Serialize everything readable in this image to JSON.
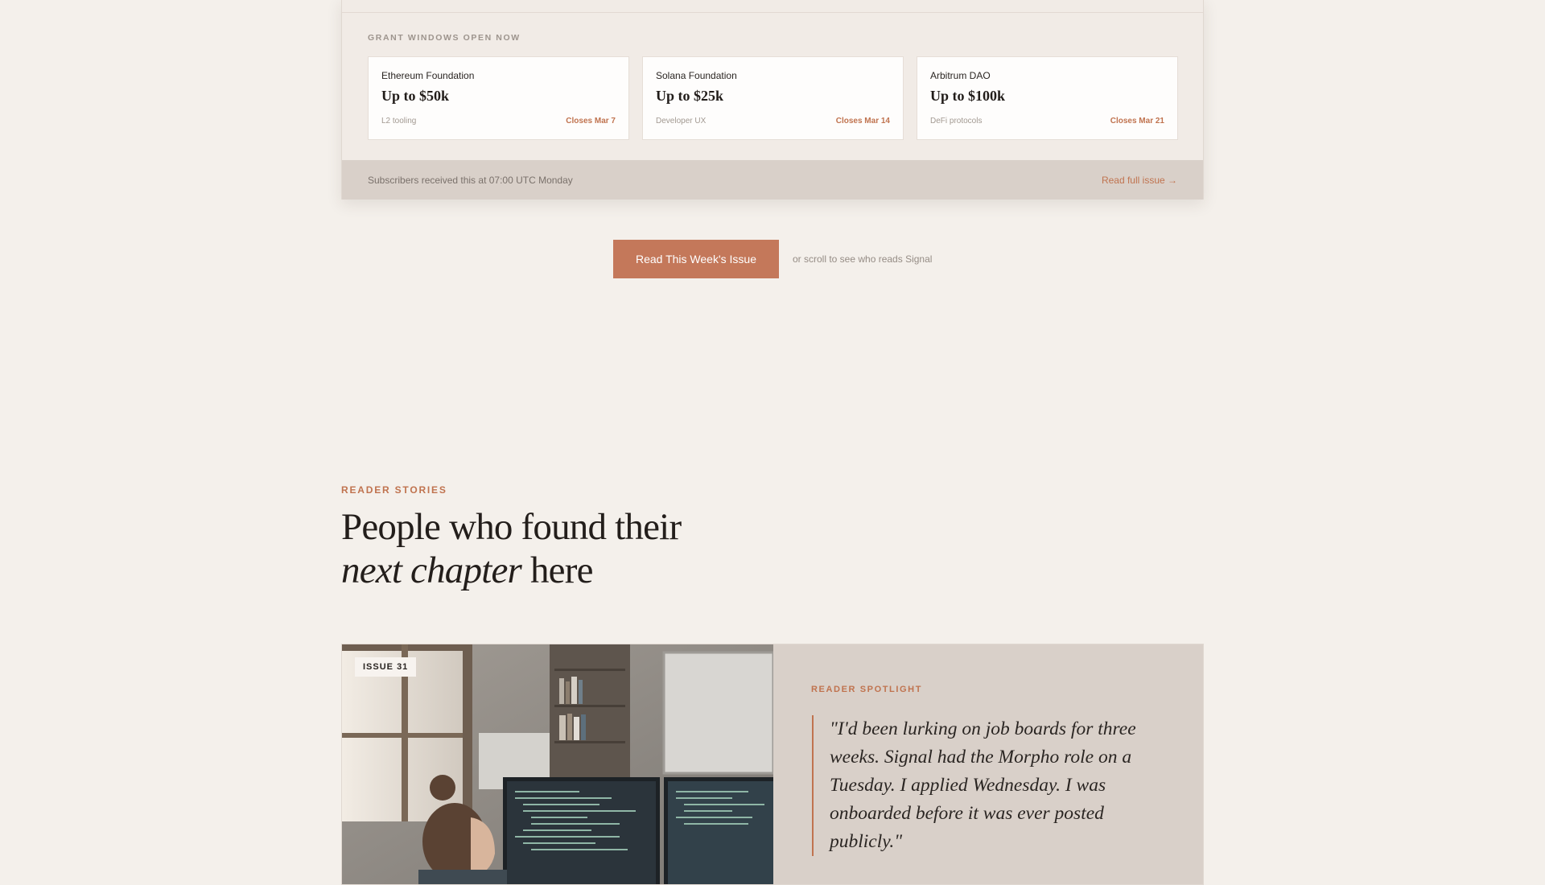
{
  "grants": {
    "heading": "GRANT WINDOWS OPEN NOW",
    "items": [
      {
        "org": "Ethereum Foundation",
        "amount": "Up to $50k",
        "tag": "L2 tooling",
        "closes": "Closes Mar 7"
      },
      {
        "org": "Solana Foundation",
        "amount": "Up to $25k",
        "tag": "Developer UX",
        "closes": "Closes Mar 14"
      },
      {
        "org": "Arbitrum DAO",
        "amount": "Up to $100k",
        "tag": "DeFi protocols",
        "closes": "Closes Mar 21"
      }
    ]
  },
  "issue_footer": {
    "note": "Subscribers received this at 07:00 UTC Monday",
    "link": "Read full issue →"
  },
  "cta": {
    "button": "Read This Week's Issue",
    "hint": "or scroll to see who reads Signal"
  },
  "stories": {
    "eyebrow": "READER STORIES",
    "headline_line1": "People who found their",
    "headline_italic": "next chapter",
    "headline_end": " here"
  },
  "spotlight": {
    "badge": "ISSUE 31",
    "eyebrow": "READER SPOTLIGHT",
    "quote": "\"I'd been lurking on job boards for three weeks. Signal had the Morpho role on a Tuesday. I applied Wednesday. I was onboarded before it was ever posted publicly.\""
  },
  "colors": {
    "accent": "#c4785a",
    "background": "#f4f0eb",
    "panel": "#d9d0c9"
  }
}
